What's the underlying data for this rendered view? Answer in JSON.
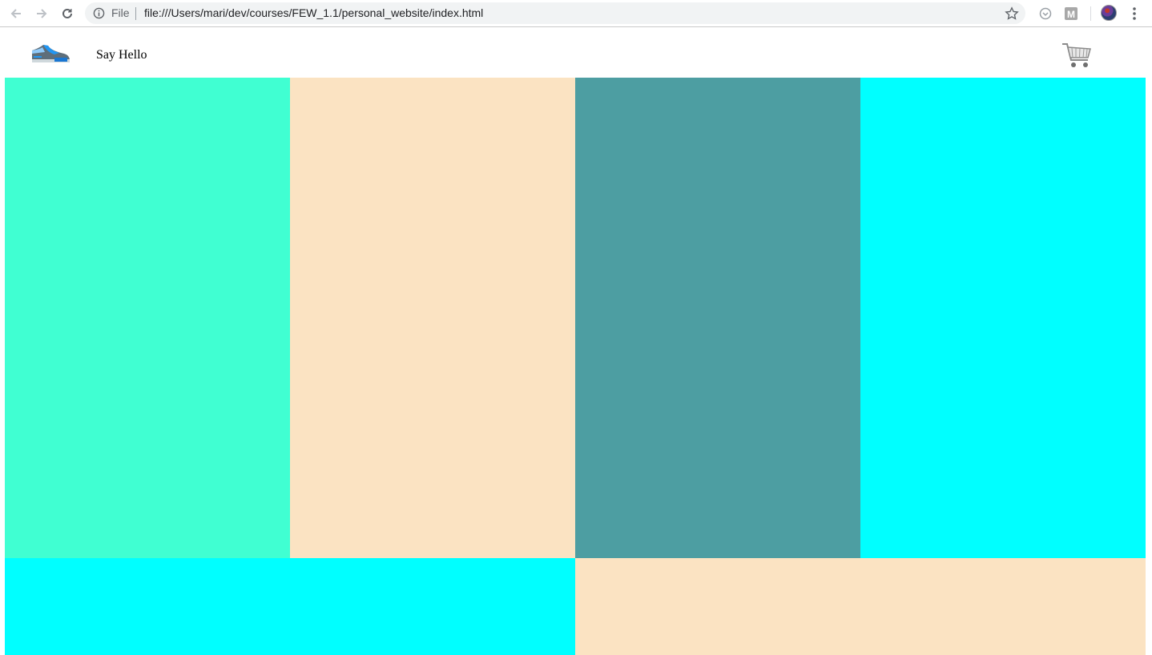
{
  "browser": {
    "scheme_label": "File",
    "url": "file:///Users/mari/dev/courses/FEW_1.1/personal_website/index.html",
    "icons": [
      "back-arrow-icon",
      "forward-arrow-icon",
      "reload-icon",
      "info-icon",
      "star-icon",
      "extension-icon",
      "extension-m-icon",
      "profile-avatar",
      "menu-dots-icon"
    ],
    "ext_m_label": "M"
  },
  "site": {
    "header": {
      "logo_icon": "sneaker-icon",
      "nav_link": "Say Hello",
      "cart_icon": "shopping-cart-icon"
    },
    "tiles_top": [
      {
        "color": "#40ffd2"
      },
      {
        "color": "#fbe3c2"
      },
      {
        "color": "#4d9ea2"
      },
      {
        "color": "#00ffff"
      }
    ],
    "tiles_bottom": [
      {
        "color": "#00ffff"
      },
      {
        "color": "#fbe3c2"
      }
    ]
  }
}
